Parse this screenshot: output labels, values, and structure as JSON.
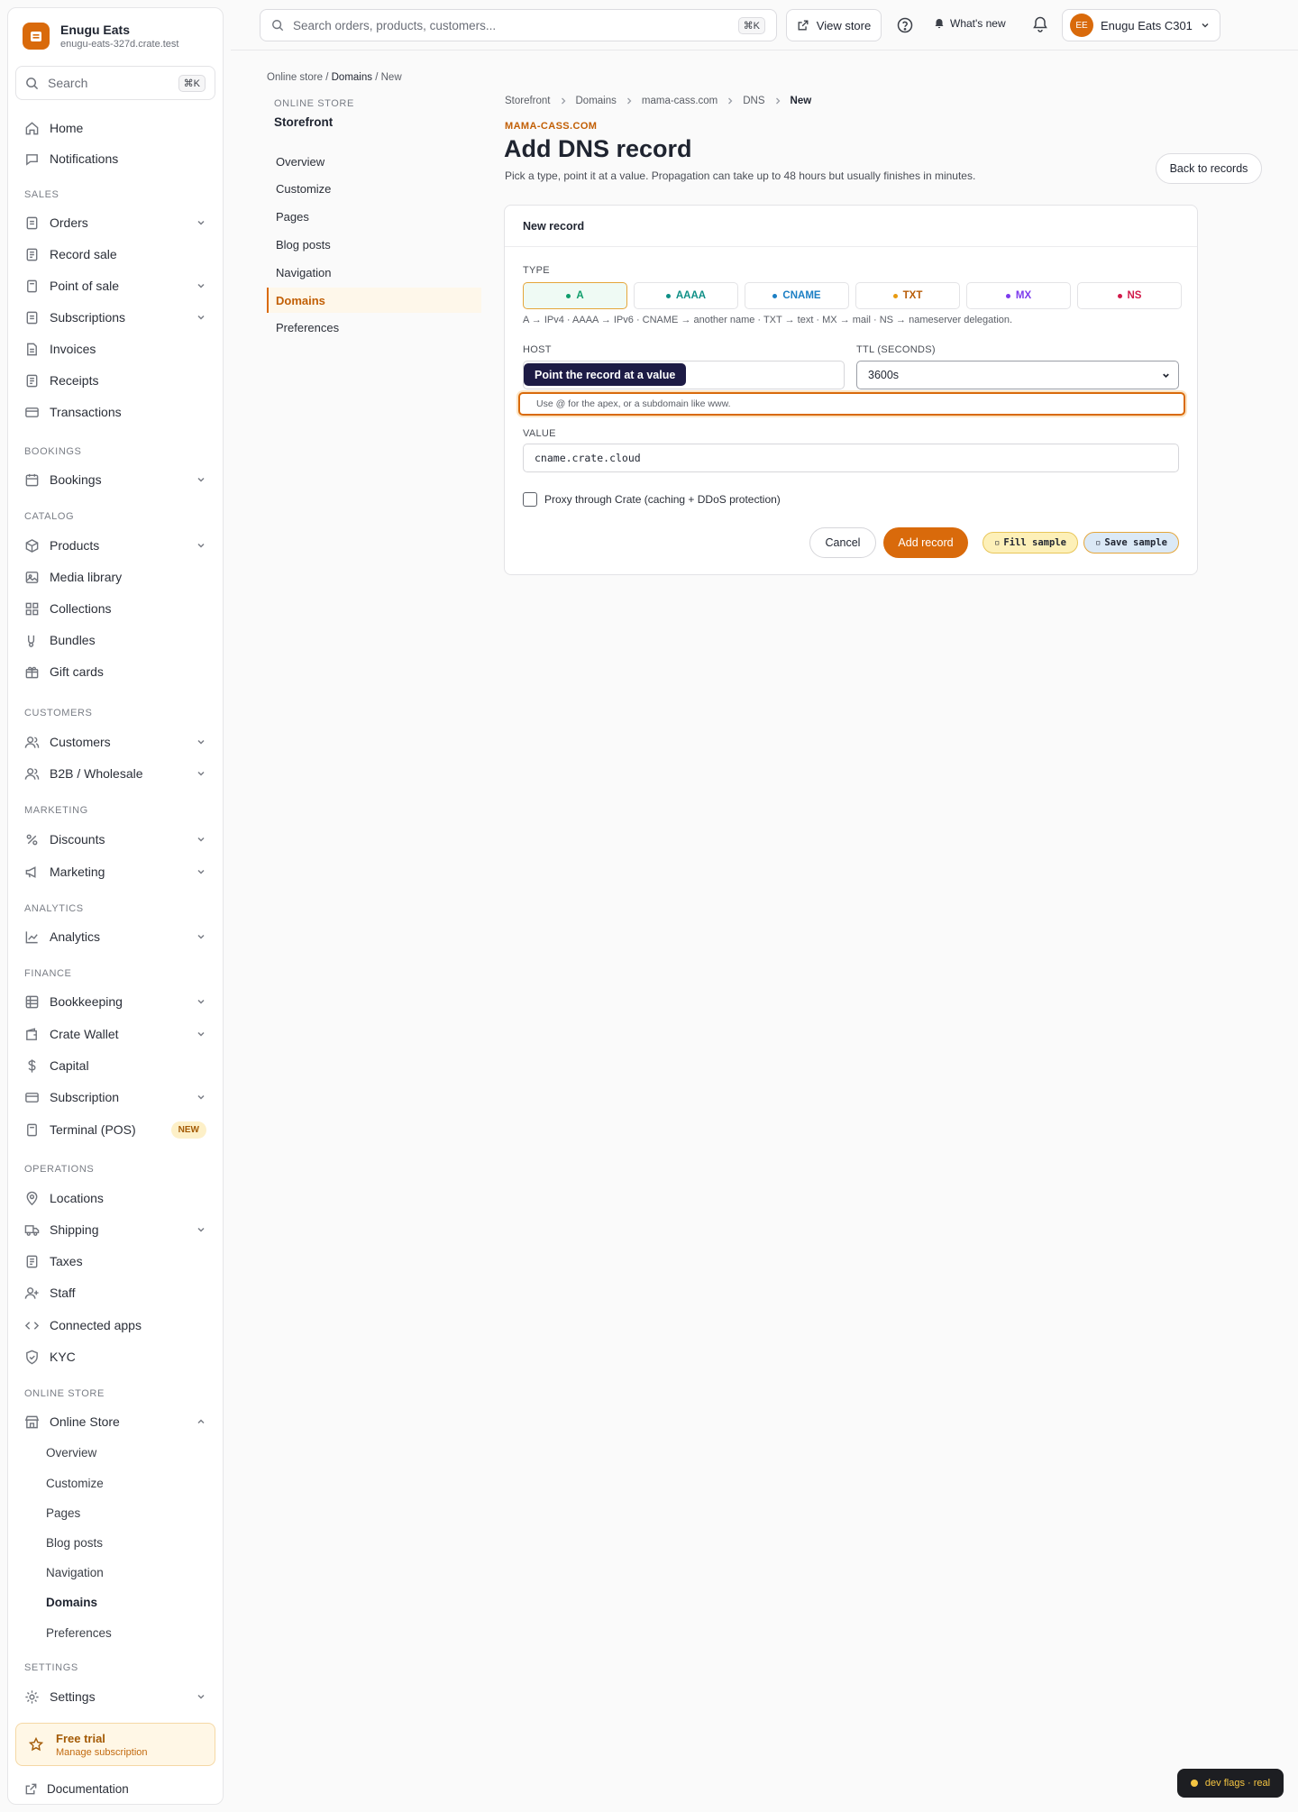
{
  "app": {
    "store_name": "Enugu Eats",
    "store_domain": "enugu-eats-327d.crate.test",
    "accent": "#d96a0b"
  },
  "sidebar": {
    "search_placeholder": "Search",
    "search_shortcut": "⌘K",
    "home": "Home",
    "notifications": "Notifications",
    "sections": {
      "sales": "SALES",
      "bookings": "BOOKINGS",
      "catalog": "CATALOG",
      "customers": "CUSTOMERS",
      "marketing": "MARKETING",
      "analytics": "ANALYTICS",
      "finance": "FINANCE",
      "operations": "OPERATIONS",
      "online_store": "ONLINE STORE",
      "settings": "SETTINGS"
    },
    "items": {
      "orders": "Orders",
      "record_sale": "Record sale",
      "point_of_sale": "Point of sale",
      "subscriptions": "Subscriptions",
      "invoices": "Invoices",
      "receipts": "Receipts",
      "transactions": "Transactions",
      "bookings": "Bookings",
      "products": "Products",
      "media_library": "Media library",
      "collections": "Collections",
      "bundles": "Bundles",
      "gift_cards": "Gift cards",
      "customers": "Customers",
      "b2b": "B2B / Wholesale",
      "discounts": "Discounts",
      "marketing": "Marketing",
      "analytics": "Analytics",
      "bookkeeping": "Bookkeeping",
      "crate_wallet": "Crate Wallet",
      "capital": "Capital",
      "subscription": "Subscription",
      "terminal": "Terminal (POS)",
      "terminal_badge": "NEW",
      "locations": "Locations",
      "shipping": "Shipping",
      "taxes": "Taxes",
      "staff": "Staff",
      "connected_apps": "Connected apps",
      "kyc": "KYC",
      "online_store": "Online Store",
      "settings": "Settings"
    },
    "online_store_sub": {
      "overview": "Overview",
      "customize": "Customize",
      "pages": "Pages",
      "blog_posts": "Blog posts",
      "navigation": "Navigation",
      "domains": "Domains",
      "preferences": "Preferences"
    },
    "trial": {
      "title": "Free trial",
      "subtitle": "Manage subscription"
    },
    "documentation": "Documentation"
  },
  "topbar": {
    "search_placeholder": "Search orders, products, customers...",
    "search_shortcut": "⌘K",
    "view_store": "View store",
    "whats_new": "What's new",
    "account_initials": "EE",
    "account_name": "Enugu Eats C301"
  },
  "page_breadcrumb": {
    "a": "Online store",
    "sep1": "/",
    "b": "Domains",
    "sep2": "/",
    "c": "New"
  },
  "subnav": {
    "label": "ONLINE STORE",
    "title": "Storefront",
    "items": {
      "overview": "Overview",
      "customize": "Customize",
      "pages": "Pages",
      "blog_posts": "Blog posts",
      "navigation": "Navigation",
      "domains": "Domains",
      "preferences": "Preferences"
    }
  },
  "main": {
    "crumbs": {
      "a": "Storefront",
      "b": "Domains",
      "c": "mama-cass.com",
      "d": "DNS",
      "e": "New"
    },
    "eyebrow": "MAMA-CASS.COM",
    "title": "Add DNS record",
    "lead": "Pick a type, point it at a value. Propagation can take up to 48 hours but usually finishes in minutes.",
    "back_button": "Back to records"
  },
  "form": {
    "card_title": "New record",
    "type_label": "TYPE",
    "types": {
      "a": {
        "label": "A",
        "color": "#0f9d6b"
      },
      "aaaa": {
        "label": "AAAA",
        "color": "#0e8f86"
      },
      "cname": {
        "label": "CNAME",
        "color": "#1c7fc4"
      },
      "txt": {
        "label": "TXT",
        "color": "#b85c07"
      },
      "mx": {
        "label": "MX",
        "color": "#7c3aed"
      },
      "ns": {
        "label": "NS",
        "color": "#d11a4a"
      }
    },
    "selected_type": "A",
    "type_hint": "A → IPv4 · AAAA → IPv6 · CNAME → another name · TXT → text · MX → mail · NS → nameserver delegation.",
    "host_label": "HOST",
    "host_value": "",
    "tooltip": "Point the record at a value",
    "host_hint": "Use @ for the apex, or a subdomain like www.",
    "ttl_label": "TTL (SECONDS)",
    "ttl_value": "3600s",
    "value_label": "VALUE",
    "value_value": "cname.crate.cloud",
    "proxy_label": "Proxy through Crate (caching + DDoS protection)",
    "proxy_checked": false,
    "cancel": "Cancel",
    "submit": "Add record",
    "fill_sample": "Fill sample",
    "save_sample": "Save sample"
  },
  "dev_flags": "dev flags · real"
}
